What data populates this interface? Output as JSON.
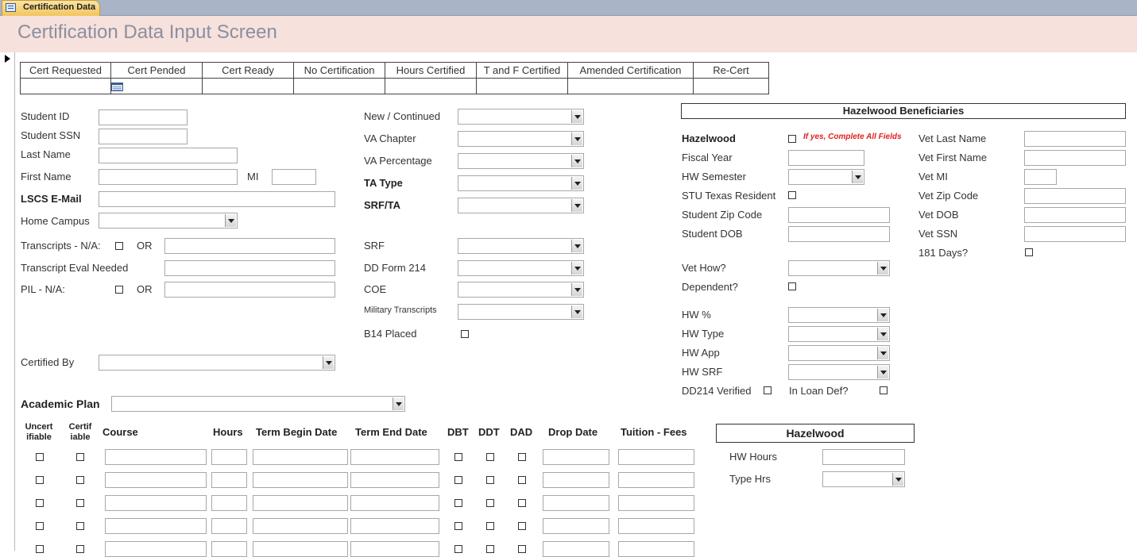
{
  "tab": {
    "label": "Certification Data"
  },
  "header": {
    "title": "Certification Data Input Screen"
  },
  "cert_status": {
    "columns": [
      "Cert Requested",
      "Cert Pended",
      "Cert Ready",
      "No Certification",
      "Hours Certified",
      "T and F Certified",
      "Amended Certification",
      "Re-Cert"
    ]
  },
  "student": {
    "student_id": "Student ID",
    "student_ssn": "Student SSN",
    "last_name": "Last Name",
    "first_name": "First Name",
    "mi": "MI",
    "email": "LSCS E-Mail",
    "home_campus": "Home Campus",
    "transcripts_na": "Transcripts - N/A:",
    "or": "OR",
    "transcript_eval": "Transcript Eval Needed",
    "pil_na": "PIL - N/A:",
    "certified_by": "Certified By",
    "academic_plan": "Academic Plan"
  },
  "va": {
    "new_continued": "New / Continued",
    "va_chapter": "VA Chapter",
    "va_percentage": "VA Percentage",
    "ta_type": "TA Type",
    "srf_ta": "SRF/TA",
    "srf": "SRF",
    "dd_form_214": "DD Form 214",
    "coe": "COE",
    "military_transcripts": "Military Transcripts",
    "b14_placed": "B14 Placed"
  },
  "hazelwood_benef": {
    "title": "Hazelwood Beneficiaries",
    "hazelwood": "Hazelwood",
    "if_yes": "If yes, Complete All Fields",
    "fiscal_year": "Fiscal Year",
    "hw_semester": "HW Semester",
    "stu_texas_resident": "STU Texas Resident",
    "student_zip": "Student Zip Code",
    "student_dob": "Student DOB",
    "vet_how": "Vet How?",
    "dependent": "Dependent?",
    "hw_pct": "HW %",
    "hw_type": "HW Type",
    "hw_app": "HW App",
    "hw_srf": "HW SRF",
    "dd214_verified": "DD214 Verified",
    "in_loan_def": "In Loan Def?",
    "vet_last_name": "Vet Last Name",
    "vet_first_name": "Vet First Name",
    "vet_mi": "Vet MI",
    "vet_zip": "Vet Zip Code",
    "vet_dob": "Vet DOB",
    "vet_ssn": "Vet SSN",
    "days_181": "181 Days?"
  },
  "courses": {
    "col_uncert": "Uncert ifiable",
    "col_certif": "Certif iable",
    "col_course": "Course",
    "col_hours": "Hours",
    "col_term_begin": "Term Begin Date",
    "col_term_end": "Term End Date",
    "col_dbt": "DBT",
    "col_ddt": "DDT",
    "col_dad": "DAD",
    "col_drop": "Drop Date",
    "col_tuition": "Tuition - Fees"
  },
  "hazelwood_box": {
    "title": "Hazelwood",
    "hw_hours": "HW Hours",
    "type_hrs": "Type Hrs"
  }
}
